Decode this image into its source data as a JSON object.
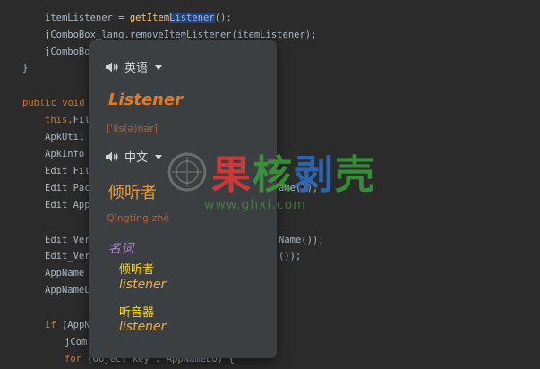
{
  "code": {
    "line1": {
      "prefix": "itemListener = ",
      "fn": "getItem",
      "hl": "Listener",
      "suffix": "();"
    },
    "line2": {
      "text": "jComboBox_lang.removeItemListener(itemListener);"
    },
    "line3": {
      "text": "jComboBox"
    },
    "line4": {
      "text": "}"
    },
    "line5": {
      "kw1": "public",
      "kw2": "void",
      "text": " ("
    },
    "line6": {
      "kw": "this",
      "text": ".File"
    },
    "line7": {
      "text": "ApkUtil a"
    },
    "line8": {
      "text": "ApkInfo a"
    },
    "line9": {
      "text": "Edit_File"
    },
    "line10": {
      "text": "Edit_Pack",
      "tail": "ame());"
    },
    "line11": {
      "text": "Edit_App"
    },
    "line12": {
      "text": "Edit_Vers",
      "tail": "Name());"
    },
    "line13": {
      "text": "Edit_Ver",
      "tail": "());"
    },
    "line14": {
      "text": "AppName ="
    },
    "line15": {
      "text": "AppNameLo"
    },
    "line16": {
      "kw": "if",
      "text": " (AppNa"
    },
    "line17": {
      "text": "jCom"
    },
    "line18": {
      "kw": "for",
      "text": " (Object key : AppNameLo) {"
    }
  },
  "popup": {
    "source_lang": "英语",
    "word": "Listener",
    "phonetic": "[ˈlis(ə)nər]",
    "target_lang": "中文",
    "translation": "倾听者",
    "pinyin": "Qīngtīng zhě",
    "pos": "名词",
    "meanings": [
      {
        "zh": "倾听者",
        "en": "listener"
      },
      {
        "zh": "听音器",
        "en": "listener"
      }
    ]
  },
  "watermark": {
    "text": [
      "果",
      "核",
      "剥",
      "壳"
    ],
    "url": "www.ghxi.com"
  }
}
